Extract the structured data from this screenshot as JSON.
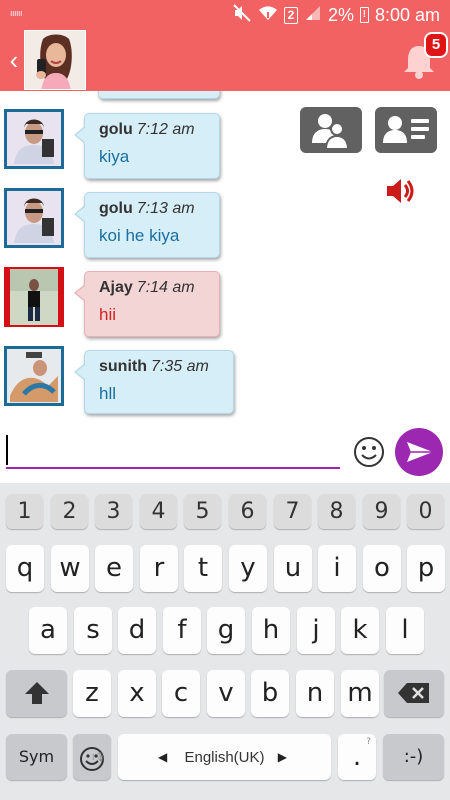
{
  "status_bar": {
    "carrier_icon_text": "ıııııı",
    "sim_number": "2",
    "battery_text": "2%",
    "battery_icon_text": "!",
    "time": "8:00 am"
  },
  "header": {
    "notification_count": "5"
  },
  "messages": [
    {
      "name": "golu",
      "time": "7:12 am",
      "text": "kiya",
      "style": "blue"
    },
    {
      "name": "golu",
      "time": "7:13 am",
      "text": "koi he kiya",
      "style": "blue"
    },
    {
      "name": "Ajay",
      "time": "7:14 am",
      "text": "hii",
      "style": "pink"
    },
    {
      "name": "sunith",
      "time": "7:35 am",
      "text": "hll",
      "style": "blue"
    }
  ],
  "composer": {
    "value": "",
    "placeholder": ""
  },
  "keyboard": {
    "number_row": [
      "1",
      "2",
      "3",
      "4",
      "5",
      "6",
      "7",
      "8",
      "9",
      "0"
    ],
    "row1": [
      "q",
      "w",
      "e",
      "r",
      "t",
      "y",
      "u",
      "i",
      "o",
      "p"
    ],
    "row2": [
      "a",
      "s",
      "d",
      "f",
      "g",
      "h",
      "j",
      "k",
      "l"
    ],
    "row3": [
      "z",
      "x",
      "c",
      "v",
      "b",
      "n",
      "m"
    ],
    "sym_label": "Sym",
    "language_label": "English(UK)",
    "period_label": ".",
    "period_hint": "?",
    "smiley_label": ":-)"
  },
  "colors": {
    "header_bg": "#f26263",
    "accent_purple": "#9c27b0",
    "bubble_blue": "#d6eef7",
    "bubble_pink": "#f4d5d6",
    "blue_text": "#1a6fa0",
    "red_text": "#d42222"
  }
}
